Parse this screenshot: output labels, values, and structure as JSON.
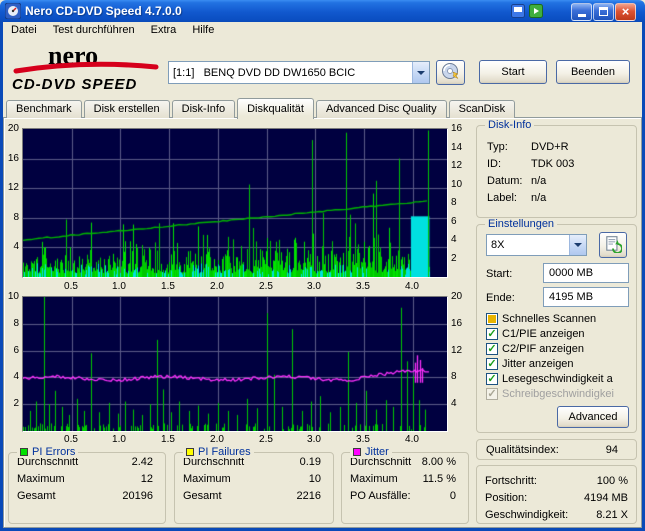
{
  "window": {
    "title": "Nero CD-DVD Speed 4.7.0.0"
  },
  "menu": {
    "items": [
      "Datei",
      "Test durchführen",
      "Extra",
      "Hilfe"
    ]
  },
  "logo": {
    "line1": "nero",
    "line2": "CD-DVD SPEED"
  },
  "toolbar": {
    "drive_select_value": "[1:1]   BENQ DVD DD DW1650 BCIC",
    "start_button": "Start",
    "quit_button": "Beenden"
  },
  "tabs": {
    "active": "Diskqualität",
    "items": [
      "Benchmark",
      "Disk erstellen",
      "Disk-Info",
      "Diskqualität",
      "Advanced Disc Quality",
      "ScanDisk"
    ]
  },
  "disk_info": {
    "title": "Disk-Info",
    "rows": [
      {
        "label": "Typ:",
        "value": "DVD+R"
      },
      {
        "label": "ID:",
        "value": "TDK 003"
      },
      {
        "label": "Datum:",
        "value": "n/a"
      },
      {
        "label": "Label:",
        "value": "n/a"
      }
    ]
  },
  "settings": {
    "title": "Einstellungen",
    "speed_select_value": "8X",
    "start_label": "Start:",
    "start_value": "0000 MB",
    "end_label": "Ende:",
    "end_value": "4195 MB",
    "checkboxes": [
      {
        "label": "Schnelles Scannen",
        "state": "partial"
      },
      {
        "label": "C1/PIE anzeigen",
        "state": "checked"
      },
      {
        "label": "C2/PIF anzeigen",
        "state": "checked"
      },
      {
        "label": "Jitter anzeigen",
        "state": "checked"
      },
      {
        "label": "Lesegeschwindigkeit a",
        "state": "checked"
      },
      {
        "label": "Schreibgeschwindigkei",
        "state": "disabled"
      }
    ],
    "advanced_button": "Advanced"
  },
  "quality_index": {
    "label": "Qualitätsindex:",
    "value": "94"
  },
  "progress": {
    "rows": [
      {
        "label": "Fortschritt:",
        "value": "100 %"
      },
      {
        "label": "Position:",
        "value": "4194 MB"
      },
      {
        "label": "Geschwindigkeit:",
        "value": "8.21 X"
      }
    ]
  },
  "stats_boxes": [
    {
      "title": "PI Errors",
      "chip_color": "#00E000",
      "rows": [
        [
          "Durchschnitt",
          "2.42"
        ],
        [
          "Maximum",
          "12"
        ],
        [
          "Gesamt",
          "20196"
        ]
      ]
    },
    {
      "title": "PI Failures",
      "chip_color": "#FFFF00",
      "rows": [
        [
          "Durchschnitt",
          "0.19"
        ],
        [
          "Maximum",
          "10"
        ],
        [
          "Gesamt",
          "2216"
        ]
      ]
    },
    {
      "title": "Jitter",
      "chip_color": "#FF00FF",
      "rows": [
        [
          "Durchschnitt",
          "8.00 %"
        ],
        [
          "Maximum",
          "11.5 %"
        ],
        [
          "PO Ausfälle:",
          "0"
        ]
      ]
    }
  ],
  "chart_data": [
    {
      "name": "pi-errors-chart",
      "type": "bar",
      "title": "PI Errors with read speed line",
      "x_unit": "GB",
      "x_max": 4.35,
      "data_end": 4.17,
      "x_ticks": [
        0.5,
        1.0,
        1.5,
        2.0,
        2.5,
        3.0,
        3.5,
        4.0
      ],
      "left_axis": {
        "min": 0,
        "max": 20,
        "ticks": [
          4,
          8,
          12,
          16,
          20
        ]
      },
      "right_axis": {
        "min": 0,
        "max": 16,
        "ticks": [
          2,
          4,
          6,
          8,
          10,
          12,
          14,
          16
        ]
      },
      "pie_average": 2.42,
      "pie_maximum": 12,
      "pie_total": 20196,
      "speed_line": {
        "start_x": 4.0,
        "end_x": 8.21
      },
      "spike_lines": [
        [
          2.32,
          12.5
        ],
        [
          2.96,
          18.5
        ],
        [
          3.31,
          19.5
        ],
        [
          3.62,
          13.0
        ],
        [
          3.86,
          16.0
        ],
        [
          4.16,
          19.8
        ]
      ],
      "end_block": {
        "from": 3.98,
        "to": 4.17,
        "height": 8.2
      },
      "colors": {
        "background": "#000040",
        "grid": "#5C5C88",
        "bars": "#00C800",
        "bars_alt": "#00E400",
        "accent": "#00E0E0",
        "speed": "#00B400"
      }
    },
    {
      "name": "pi-failures-jitter-chart",
      "type": "bar+line",
      "title": "PI Failures with jitter line",
      "x_unit": "GB",
      "x_max": 4.35,
      "data_end": 4.17,
      "x_ticks": [
        0.5,
        1.0,
        1.5,
        2.0,
        2.5,
        3.0,
        3.5,
        4.0
      ],
      "left_axis": {
        "min": 0,
        "max": 10,
        "ticks": [
          2,
          4,
          6,
          8,
          10
        ]
      },
      "right_axis": {
        "min": 0,
        "max": 20,
        "ticks": [
          4,
          8,
          12,
          16,
          20
        ]
      },
      "pif_average": 0.19,
      "pif_maximum": 10,
      "pif_total": 2216,
      "jitter_average_pct": 8.0,
      "jitter_maximum_pct": 11.5,
      "po_failures": 0,
      "pif_spikes": [
        [
          0.07,
          1.5
        ],
        [
          0.13,
          2.2
        ],
        [
          0.22,
          10.0
        ],
        [
          0.27,
          2.0
        ],
        [
          0.33,
          3.0
        ],
        [
          0.4,
          1.8
        ],
        [
          0.47,
          1.2
        ],
        [
          0.55,
          2.4
        ],
        [
          0.63,
          1.5
        ],
        [
          0.7,
          5.8
        ],
        [
          0.78,
          1.4
        ],
        [
          0.88,
          2.1
        ],
        [
          0.97,
          1.3
        ],
        [
          1.05,
          2.2
        ],
        [
          1.13,
          1.6
        ],
        [
          1.22,
          1.2
        ],
        [
          1.3,
          2.0
        ],
        [
          1.37,
          6.8
        ],
        [
          1.44,
          3.1
        ],
        [
          1.52,
          1.4
        ],
        [
          1.6,
          2.2
        ],
        [
          1.7,
          1.5
        ],
        [
          1.8,
          1.9
        ],
        [
          1.9,
          1.3
        ],
        [
          2.0,
          2.1
        ],
        [
          2.1,
          1.5
        ],
        [
          2.2,
          1.2
        ],
        [
          2.3,
          2.4
        ],
        [
          2.4,
          1.7
        ],
        [
          2.5,
          8.8
        ],
        [
          2.57,
          4.2
        ],
        [
          2.66,
          1.8
        ],
        [
          2.76,
          7.6
        ],
        [
          2.86,
          1.5
        ],
        [
          2.95,
          2.2
        ],
        [
          3.05,
          2.6
        ],
        [
          3.15,
          1.4
        ],
        [
          3.25,
          1.8
        ],
        [
          3.33,
          5.9
        ],
        [
          3.42,
          2.1
        ],
        [
          3.52,
          3.0
        ],
        [
          3.62,
          1.6
        ],
        [
          3.72,
          2.3
        ],
        [
          3.8,
          1.8
        ],
        [
          3.88,
          9.2
        ],
        [
          3.94,
          5.2
        ],
        [
          4.0,
          4.1
        ],
        [
          4.06,
          2.3
        ],
        [
          4.12,
          1.6
        ]
      ],
      "jitter_end_spikes": [
        [
          4.02,
          10.2
        ],
        [
          4.045,
          11.3
        ],
        [
          4.07,
          10.6
        ],
        [
          4.095,
          9.4
        ]
      ],
      "colors": {
        "background": "#000040",
        "grid": "#5C5C88",
        "bars": "#00C800",
        "jitter": "#FF30FF"
      }
    }
  ]
}
